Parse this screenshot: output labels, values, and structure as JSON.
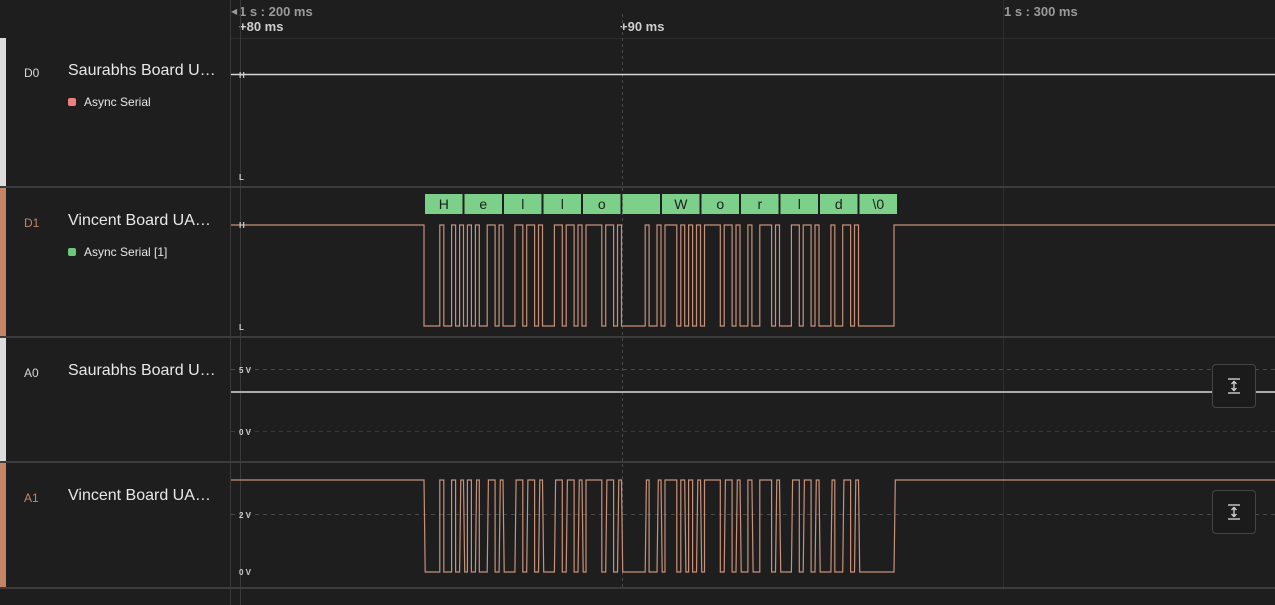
{
  "timeline": {
    "abs_left": "1 s : 200 ms",
    "abs_right": "1 s : 300 ms",
    "rel_left": "+80 ms",
    "rel_mid": "+90 ms"
  },
  "channels": [
    {
      "id": "D0",
      "name": "Saurabhs Board UA…",
      "analyzer": "Async Serial",
      "high": "H",
      "low": "L"
    },
    {
      "id": "D1",
      "name": "Vincent Board UAR…",
      "analyzer": "Async Serial [1]",
      "high": "H",
      "low": "L"
    },
    {
      "id": "A0",
      "name": "Saurabhs Board UA…",
      "top": "5 V",
      "bottom": "0 V"
    },
    {
      "id": "A1",
      "name": "Vincent Board UAR…",
      "top": "2 V",
      "bottom": "0 V"
    }
  ],
  "decoded_bytes": [
    "H",
    "e",
    "l",
    "l",
    "o",
    " ",
    "W",
    "o",
    "r",
    "l",
    "d",
    "\\0"
  ],
  "colors": {
    "signal": "#c8917a",
    "idle_white": "#d8d8d8",
    "decode_bg": "#7dd08a",
    "digital_accent": "#c48566",
    "analog_accent": "#c48566",
    "white_bar": "#dcdcdc",
    "dot_red": "#f08080",
    "dot_green": "#6cc87a"
  },
  "icons": {
    "scale_button": "fit-vertical-icon"
  }
}
